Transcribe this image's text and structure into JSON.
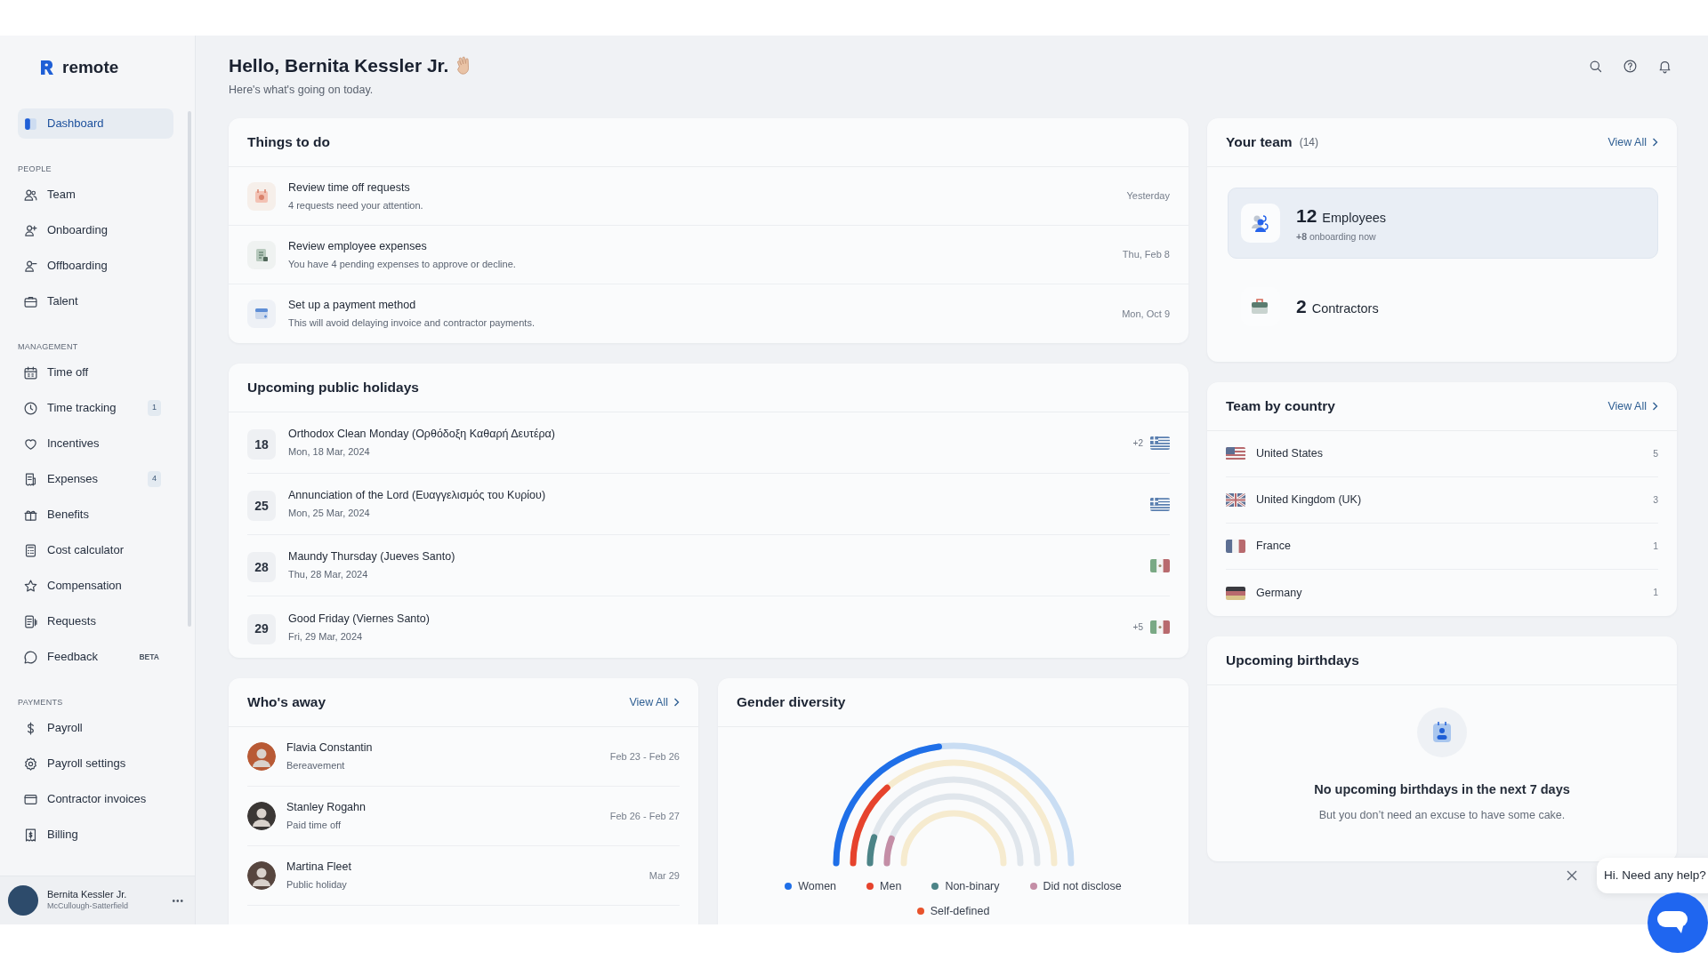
{
  "sidebar": {
    "brand": "remote",
    "top_items": [
      {
        "label": "Dashboard",
        "selected": true
      }
    ],
    "sections": [
      {
        "heading": "PEOPLE",
        "items": [
          {
            "label": "Team",
            "selected": false
          },
          {
            "label": "Onboarding",
            "selected": false
          },
          {
            "label": "Offboarding",
            "selected": false
          },
          {
            "label": "Talent",
            "selected": false
          }
        ]
      },
      {
        "heading": "MANAGEMENT",
        "items": [
          {
            "label": "Time off",
            "selected": false
          },
          {
            "label": "Time tracking",
            "selected": false,
            "badge": "1"
          },
          {
            "label": "Incentives",
            "selected": false
          },
          {
            "label": "Expenses",
            "selected": false,
            "badge": "4"
          },
          {
            "label": "Benefits",
            "selected": false
          },
          {
            "label": "Cost calculator",
            "selected": false
          },
          {
            "label": "Compensation",
            "selected": false
          },
          {
            "label": "Requests",
            "selected": false
          },
          {
            "label": "Feedback",
            "selected": false,
            "tag": "BETA"
          }
        ]
      },
      {
        "heading": "PAYMENTS",
        "items": [
          {
            "label": "Payroll",
            "selected": false
          },
          {
            "label": "Payroll settings",
            "selected": false
          },
          {
            "label": "Contractor invoices",
            "selected": false
          },
          {
            "label": "Billing",
            "selected": false
          }
        ]
      }
    ],
    "user": {
      "name": "Bernita Kessler Jr.",
      "company": "McCullough-Satterfield",
      "menu": "•••"
    }
  },
  "header": {
    "greeting": "Hello, Bernita Kessler Jr.",
    "subtitle": "Here's what's going on today."
  },
  "things_to_do": {
    "title": "Things to do",
    "tasks": [
      {
        "title": "Review time off requests",
        "description": "4 requests need your attention.",
        "date": "Yesterday"
      },
      {
        "title": "Review employee expenses",
        "description": "You have 4 pending expenses to approve or decline.",
        "date": "Thu, Feb 8"
      },
      {
        "title": "Set up a payment method",
        "description": "This will avoid delaying invoice and contractor payments.",
        "date": "Mon, Oct 9"
      }
    ]
  },
  "holidays": {
    "title": "Upcoming public holidays",
    "items": [
      {
        "day": "18",
        "name": "Orthodox Clean Monday (Ορθόδοξη Καθαρή Δευτέρα)",
        "date": "Mon, 18 Mar, 2024",
        "more": "+2"
      },
      {
        "day": "25",
        "name": "Annunciation of the Lord (Ευαγγελισμός του Κυρίου)",
        "date": "Mon, 25 Mar, 2024"
      },
      {
        "day": "28",
        "name": "Maundy Thursday (Jueves Santo)",
        "date": "Thu, 28 Mar, 2024"
      },
      {
        "day": "29",
        "name": "Good Friday (Viernes Santo)",
        "date": "Fri, 29 Mar, 2024",
        "more": "+5"
      }
    ]
  },
  "whos_away": {
    "title": "Who's away",
    "link": "View All",
    "people": [
      {
        "name": "Flavia Constantin",
        "reason": "Bereavement",
        "dates": "Feb 23 - Feb 26"
      },
      {
        "name": "Stanley Rogahn",
        "reason": "Paid time off",
        "dates": "Feb 26 - Feb 27"
      },
      {
        "name": "Martina Fleet",
        "reason": "Public holiday",
        "dates": "Mar 29"
      }
    ]
  },
  "gender": {
    "title": "Gender diversity",
    "groups": [
      {
        "label": "Women",
        "color": "#1f6fe8"
      },
      {
        "label": "Men",
        "color": "#e6432d"
      },
      {
        "label": "Non-binary",
        "color": "#4c8487"
      },
      {
        "label": "Did not disclose",
        "color": "#c48ea6"
      },
      {
        "label": "Self-defined",
        "color": "#e8532c"
      }
    ]
  },
  "team": {
    "title": "Your team",
    "count": "(14)",
    "link": "View All",
    "stats": [
      {
        "number": "12",
        "label": "Employees",
        "note": "**+8** onboarding now",
        "selected": true
      },
      {
        "number": "2",
        "label": "Contractors",
        "selected": false
      }
    ]
  },
  "countries": {
    "title": "Team by country",
    "link": "View All",
    "items": [
      {
        "name": "United States",
        "count": "5"
      },
      {
        "name": "United Kingdom (UK)",
        "count": "3"
      },
      {
        "name": "France",
        "count": "1"
      },
      {
        "name": "Germany",
        "count": "1"
      }
    ]
  },
  "birthdays": {
    "title": "Upcoming birthdays",
    "empty_title": "No upcoming birthdays in the next 7 days",
    "empty_text": "But you don’t need an excuse to have some cake."
  },
  "chat": {
    "message": "Hi. Need any help?"
  }
}
